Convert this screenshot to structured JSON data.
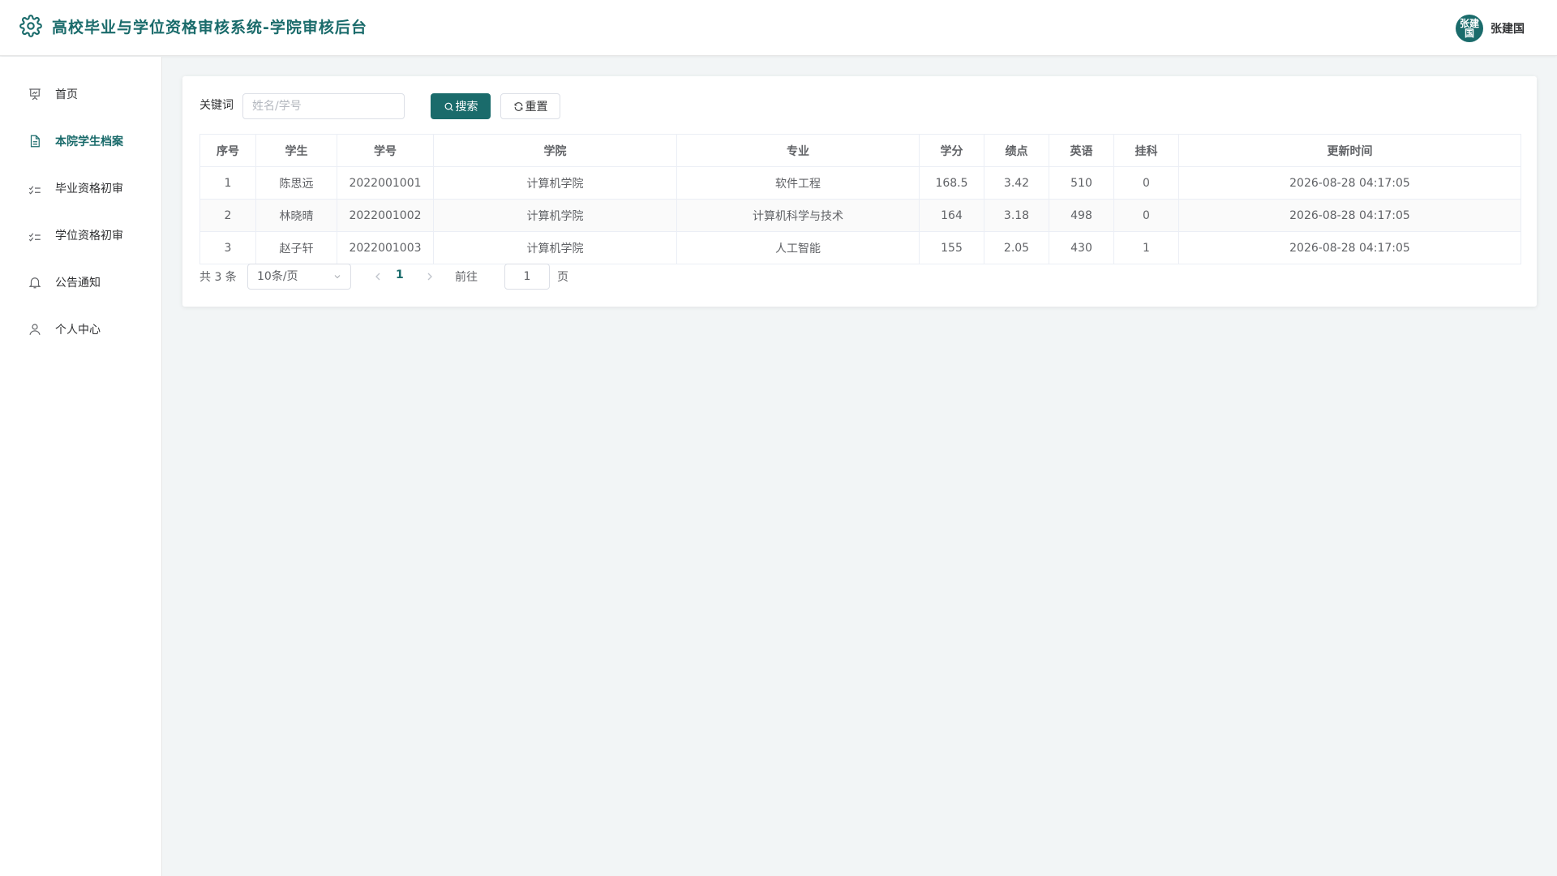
{
  "header": {
    "title": "高校毕业与学位资格审核系统-学院审核后台",
    "avatar_text": "张建国",
    "user_name": "张建国"
  },
  "sidebar": {
    "items": [
      {
        "label": "首页",
        "icon": "presentation-chart-icon"
      },
      {
        "label": "本院学生档案",
        "icon": "document-icon",
        "active": true
      },
      {
        "label": "毕业资格初审",
        "icon": "checklist-icon"
      },
      {
        "label": "学位资格初审",
        "icon": "checklist-icon"
      },
      {
        "label": "公告通知",
        "icon": "bell-icon"
      },
      {
        "label": "个人中心",
        "icon": "user-icon"
      }
    ]
  },
  "search": {
    "label": "关键词",
    "placeholder": "姓名/学号",
    "value": "",
    "search_button": "搜索",
    "reset_button": "重置"
  },
  "table": {
    "columns": [
      "序号",
      "学生",
      "学号",
      "学院",
      "专业",
      "学分",
      "绩点",
      "英语",
      "挂科",
      "更新时间"
    ],
    "rows": [
      [
        "1",
        "陈思远",
        "2022001001",
        "计算机学院",
        "软件工程",
        "168.5",
        "3.42",
        "510",
        "0",
        "2026-08-28 04:17:05"
      ],
      [
        "2",
        "林晓晴",
        "2022001002",
        "计算机学院",
        "计算机科学与技术",
        "164",
        "3.18",
        "498",
        "0",
        "2026-08-28 04:17:05"
      ],
      [
        "3",
        "赵子轩",
        "2022001003",
        "计算机学院",
        "人工智能",
        "155",
        "2.05",
        "430",
        "1",
        "2026-08-28 04:17:05"
      ]
    ]
  },
  "pagination": {
    "total_text": "共 3 条",
    "page_size": "10条/页",
    "current_page": "1",
    "goto_label": "前往",
    "goto_value": "1",
    "page_unit": "页"
  },
  "colors": {
    "primary": "#1a6b6b",
    "background": "#f2f5f6"
  }
}
